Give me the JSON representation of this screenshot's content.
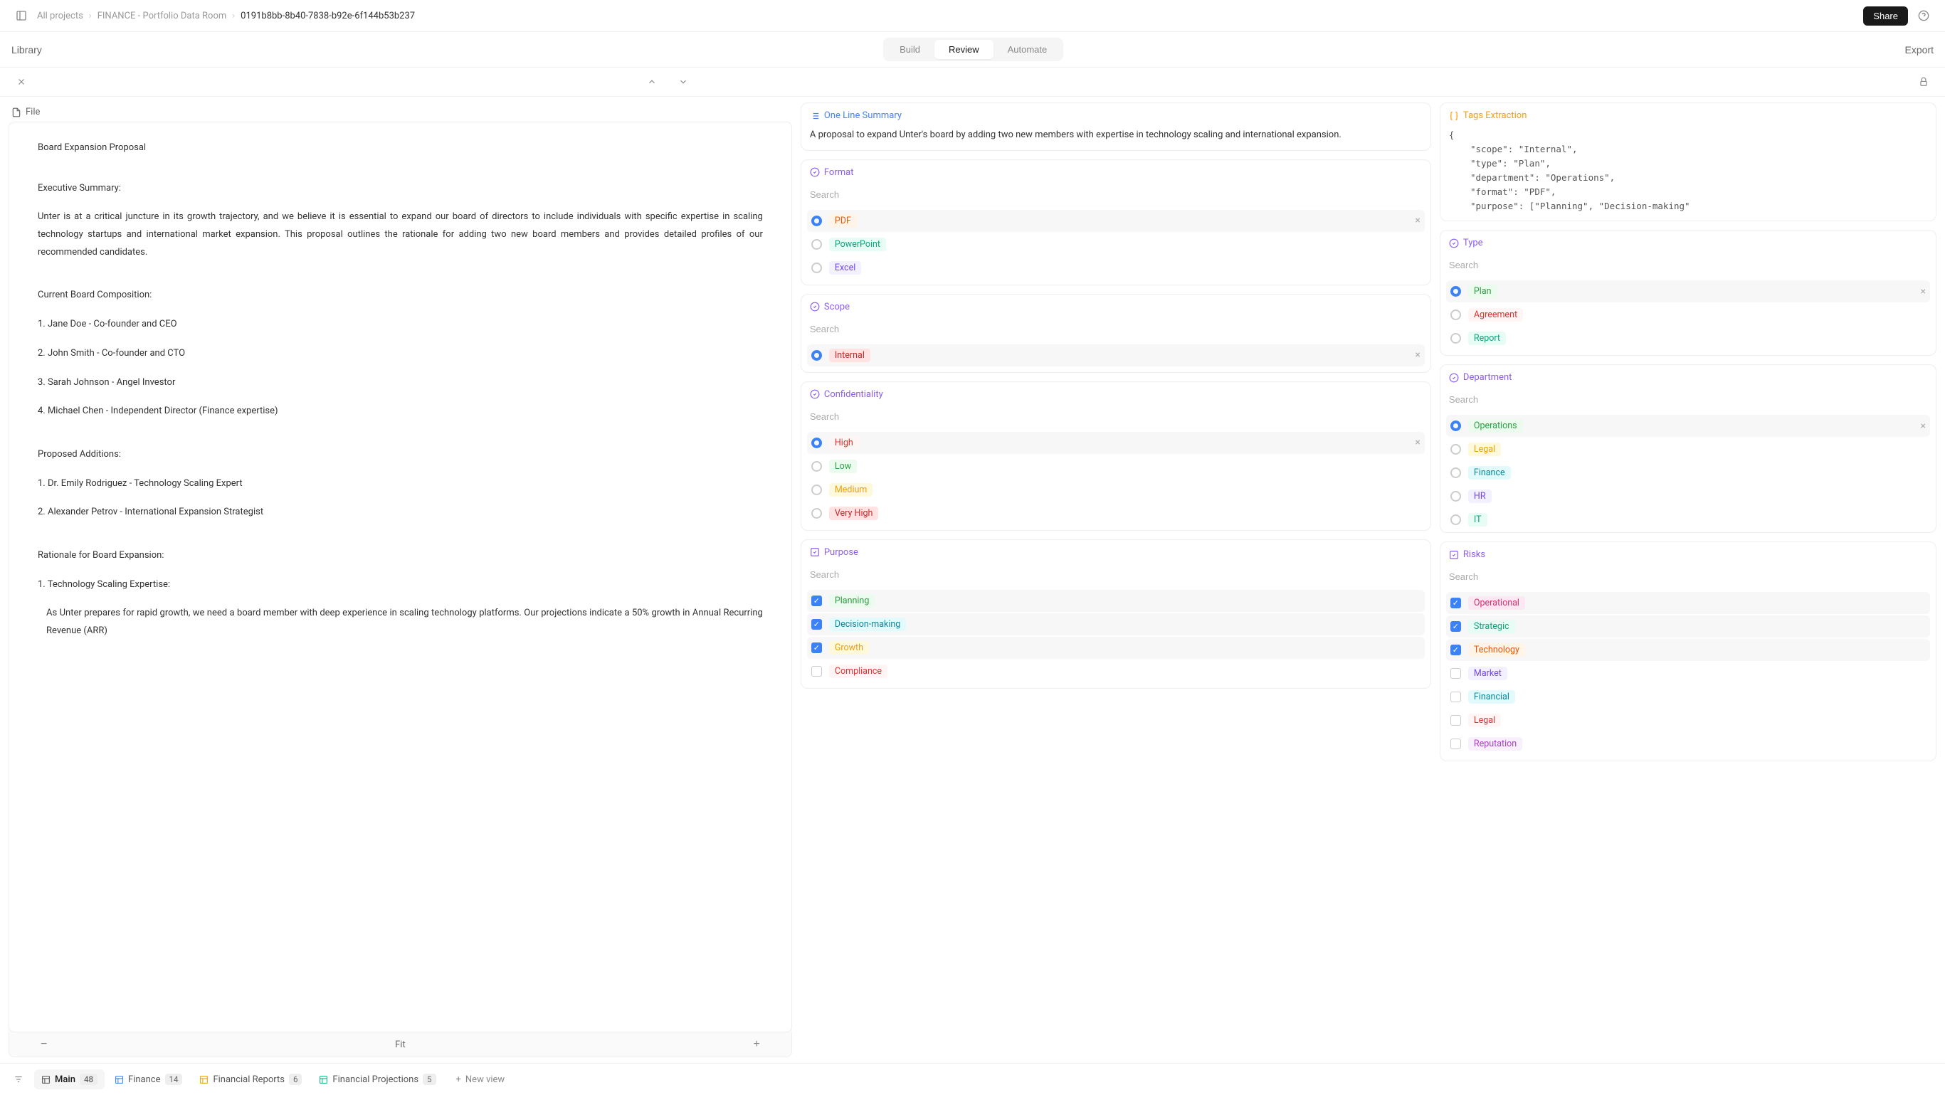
{
  "topbar": {
    "breadcrumbs": [
      "All projects",
      "FINANCE - Portfolio Data Room",
      "0191b8bb-8b40-7838-b92e-6f144b53b237"
    ],
    "share_label": "Share"
  },
  "secondbar": {
    "library_label": "Library",
    "modes": [
      "Build",
      "Review",
      "Automate"
    ],
    "active_mode": "Review",
    "export_label": "Export"
  },
  "file_panel": {
    "header": "File",
    "zoom_fit": "Fit",
    "body": {
      "title": "Board Expansion Proposal",
      "exec_header": "Executive Summary:",
      "exec_text": "Unter is at a critical juncture in its growth trajectory, and we believe it is essential to expand our board of directors to include individuals with specific expertise in scaling technology startups and international market expansion. This proposal outlines the rationale for adding two new board members and provides detailed profiles of our recommended candidates.",
      "current_header": "Current Board Composition:",
      "current_list": [
        "1. Jane Doe - Co-founder and CEO",
        "2. John Smith - Co-founder and CTO",
        "3. Sarah Johnson - Angel Investor",
        "4. Michael Chen - Independent Director (Finance expertise)"
      ],
      "proposed_header": "Proposed Additions:",
      "proposed_list": [
        "1. Dr. Emily Rodriguez - Technology Scaling Expert",
        "2. Alexander Petrov - International Expansion Strategist"
      ],
      "rationale_header": "Rationale for Board Expansion:",
      "rationale_1_header": "1. Technology Scaling Expertise:",
      "rationale_1_text": "As Unter prepares for rapid growth, we need a board member with deep experience in scaling technology platforms. Our projections indicate a 50% growth in Annual Recurring Revenue (ARR)"
    }
  },
  "summary_card": {
    "header": "One Line Summary",
    "text": "A proposal to expand Unter's board by adding two new members with expertise in technology scaling and international expansion."
  },
  "tags_card": {
    "header": "Tags Extraction",
    "lines": [
      "{",
      "    \"scope\": \"Internal\",",
      "    \"type\": \"Plan\",",
      "    \"department\": \"Operations\",",
      "    \"format\": \"PDF\",",
      "    \"purpose\": [\"Planning\", \"Decision-making\""
    ]
  },
  "search_placeholder": "Search",
  "format_card": {
    "header": "Format",
    "options": [
      {
        "label": "PDF",
        "selected": true,
        "tag": "tag-orange"
      },
      {
        "label": "PowerPoint",
        "selected": false,
        "tag": "tag-teal"
      },
      {
        "label": "Excel",
        "selected": false,
        "tag": "tag-violet"
      }
    ]
  },
  "type_card": {
    "header": "Type",
    "options": [
      {
        "label": "Plan",
        "selected": true,
        "tag": "tag-green"
      },
      {
        "label": "Agreement",
        "selected": false,
        "tag": "tag-red"
      },
      {
        "label": "Report",
        "selected": false,
        "tag": "tag-teal"
      }
    ]
  },
  "scope_card": {
    "header": "Scope",
    "options": [
      {
        "label": "Internal",
        "selected": true,
        "tag": "tag-redlite"
      }
    ]
  },
  "department_card": {
    "header": "Department",
    "options": [
      {
        "label": "Operations",
        "selected": true,
        "tag": "tag-green"
      },
      {
        "label": "Legal",
        "selected": false,
        "tag": "tag-yellow"
      },
      {
        "label": "Finance",
        "selected": false,
        "tag": "tag-cyan"
      },
      {
        "label": "HR",
        "selected": false,
        "tag": "tag-violet"
      },
      {
        "label": "IT",
        "selected": false,
        "tag": "tag-teal"
      }
    ]
  },
  "confidentiality_card": {
    "header": "Confidentiality",
    "options": [
      {
        "label": "High",
        "selected": true,
        "tag": "tag-red"
      },
      {
        "label": "Low",
        "selected": false,
        "tag": "tag-green"
      },
      {
        "label": "Medium",
        "selected": false,
        "tag": "tag-yellow"
      },
      {
        "label": "Very High",
        "selected": false,
        "tag": "tag-redlite"
      }
    ]
  },
  "purpose_card": {
    "header": "Purpose",
    "options": [
      {
        "label": "Planning",
        "checked": true,
        "tag": "tag-green"
      },
      {
        "label": "Decision-making",
        "checked": true,
        "tag": "tag-cyan"
      },
      {
        "label": "Growth",
        "checked": true,
        "tag": "tag-yellow"
      },
      {
        "label": "Compliance",
        "checked": false,
        "tag": "tag-red"
      }
    ]
  },
  "risks_card": {
    "header": "Risks",
    "options": [
      {
        "label": "Operational",
        "checked": true,
        "tag": "tag-pink"
      },
      {
        "label": "Strategic",
        "checked": true,
        "tag": "tag-teal"
      },
      {
        "label": "Technology",
        "checked": true,
        "tag": "tag-orange"
      },
      {
        "label": "Market",
        "checked": false,
        "tag": "tag-violet"
      },
      {
        "label": "Financial",
        "checked": false,
        "tag": "tag-cyan"
      },
      {
        "label": "Legal",
        "checked": false,
        "tag": "tag-red"
      },
      {
        "label": "Reputation",
        "checked": false,
        "tag": "tag-purplelite"
      }
    ]
  },
  "bottombar": {
    "tabs": [
      {
        "label": "Main",
        "count": "48",
        "active": true,
        "color": "#555"
      },
      {
        "label": "Finance",
        "count": "14",
        "active": false,
        "color": "#3b82f6"
      },
      {
        "label": "Financial Reports",
        "count": "6",
        "active": false,
        "color": "#f59e0b"
      },
      {
        "label": "Financial Projections",
        "count": "5",
        "active": false,
        "color": "#10b981"
      }
    ],
    "new_view": "New view"
  }
}
